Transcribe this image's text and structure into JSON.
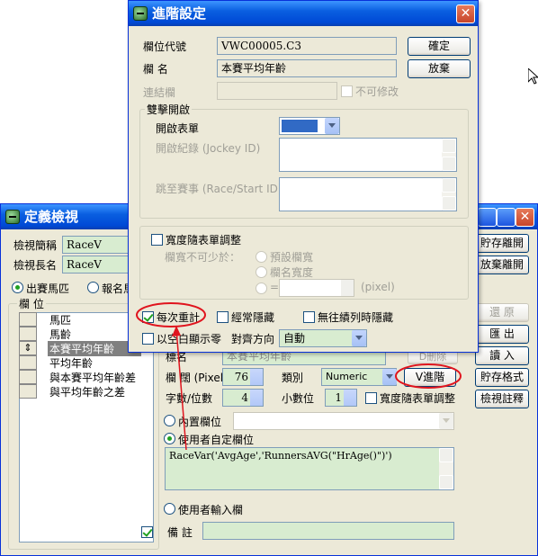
{
  "desktop": {
    "cursor": "arrow-cursor"
  },
  "bg_window": {
    "title": "定義檢視",
    "name_short_label": "檢視簡稱",
    "name_short_value": "RaceV",
    "name_long_label": "檢視長名",
    "name_long_value": "RaceV",
    "radio_horses": "出賽馬匹",
    "radio_signup": "報名馬",
    "fields_label": "欄 位",
    "field_list": [
      "馬匹",
      "馬齡",
      "本賽平均年齡",
      "平均年齡",
      "與本賽平均年齡差",
      "與平均年齡之差"
    ],
    "right_buttons": {
      "save_open": "貯存離開",
      "discard_open": "放棄離開",
      "restore": "還 原",
      "export": "匯 出",
      "import": "讀 入",
      "save_format": "貯存格式",
      "view_notes": "檢視註釋"
    },
    "name_field_label": "標名",
    "name_field_value": "本賽平均年齡",
    "delete_button": "D刪除",
    "width_label": "欄 闊 (Pixel)",
    "width_value": "76",
    "type_label": "類別",
    "type_value": "Numeric",
    "advanced_button": "V進階",
    "digits_label": "字數/位數",
    "digits_value": "4",
    "decimals_label": "小數位",
    "decimals_value": "1",
    "auto_width_label": "寬度隨表單調整",
    "builtin_radio": "內置欄位",
    "custom_radio": "使用者自定欄位",
    "formula": "RaceVar('AvgAge','RunnersAVG(\"HrAge()\")')",
    "user_input_radio": "使用者輸入欄",
    "notes_label": "備 註"
  },
  "dialog": {
    "title": "進階設定",
    "field_code_label": "欄位代號",
    "field_code_value": "VWC00005.C3",
    "field_name_label": "欄 名",
    "field_name_value": "本賽平均年齡",
    "link_label": "連結欄",
    "link_value": "",
    "readonly_label": "不可修改",
    "ok_button": "確定",
    "cancel_button": "放棄",
    "dblclick_group": "雙擊開啟",
    "open_form_label": "開啟表單",
    "open_record_label": "開啟紀錄 (Jockey ID)",
    "jump_race_label": "跳至賽事 (Race/Start ID)",
    "width_follow_label": "寬度隨表單調整",
    "min_width_label": "欄寬不可少於：",
    "preset_width": "預設欄寬",
    "header_width": "欄名寬度",
    "eq_label": "=",
    "pixel_label": "(pixel)",
    "recalc_label": "每次重計",
    "always_hide_label": "經常隱藏",
    "hide_when_no_list_label": "無往績列時隱藏",
    "blank_zero_label": "以空白顯示零",
    "align_label": "對齊方向",
    "align_value": "自動"
  },
  "colors": {
    "title_blue": "#0a5fe0",
    "highlight_red": "#e0141e",
    "green_field": "#d8ecd0",
    "window_face": "#ece9d8"
  }
}
